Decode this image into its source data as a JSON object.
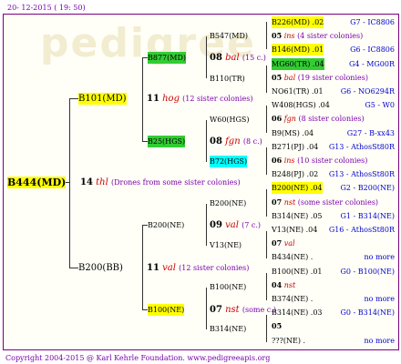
{
  "header_date": "20- 12-2015 ( 19: 50)",
  "footer": "Copyright 2004-2015 @ Karl Kehrle Foundation.   www.pedigreeapis.org",
  "watermark": "pedigree",
  "root": {
    "id": "B444(MD)"
  },
  "gen1": [
    {
      "id": "B101(MD)",
      "year": "11",
      "name": "hog",
      "note": "(12 sister colonies)"
    },
    {
      "id": "B200(BB)",
      "year": "11",
      "name": "val",
      "note": "(12 sister colonies)"
    }
  ],
  "root_mid": {
    "year": "14",
    "name": "thl",
    "note": "(Drones from some sister colonies)"
  },
  "gen2": [
    {
      "id": "B877(MD)",
      "year": "08",
      "name": "bal",
      "note": "(15 c.)"
    },
    {
      "id": "B25(HGS)",
      "year": "08",
      "name": "fgn",
      "note": "(8 c.)"
    },
    {
      "id": "B200(NE)",
      "year": "09",
      "name": "val",
      "note": "(7 c.)"
    },
    {
      "id": "B100(NE)",
      "year": "07",
      "name": "nst",
      "note": "(some c.)"
    }
  ],
  "gen3": [
    {
      "id": "B547(MD)"
    },
    {
      "id": "B110(TR)"
    },
    {
      "id": "W60(HGS)"
    },
    {
      "id": "B72(HGS)"
    },
    {
      "id": "B200(NE)"
    },
    {
      "id": "V13(NE)"
    },
    {
      "id": "B100(NE)"
    },
    {
      "id": "B314(NE)"
    }
  ],
  "gen4": [
    {
      "queen": "B226(MD) .02",
      "right": "G7 - IC8806"
    },
    {
      "year": "05",
      "name": "ins",
      "note": "(4 sister colonies)"
    },
    {
      "queen": "B146(MD) .01",
      "right": "G6 - IC8806"
    },
    {
      "queen": "MG60(TR) .04",
      "right": "G4 - MG00R"
    },
    {
      "year": "05",
      "name": "bal",
      "note": "(19 sister colonies)"
    },
    {
      "queen": "NO61(TR) .01",
      "right": "G6 - NO6294R"
    },
    {
      "queen": "W408(HGS) .04",
      "right": "G5 - W0"
    },
    {
      "year": "06",
      "name": "fgn",
      "note": "(8 sister colonies)"
    },
    {
      "queen": "B9(MS) .04",
      "right": "G27 - B-xx43"
    },
    {
      "queen": "B271(PJ) .04",
      "right": "G13 - AthosSt80R"
    },
    {
      "year": "06",
      "name": "ins",
      "note": "(10 sister colonies)"
    },
    {
      "queen": "B248(PJ) .02",
      "right": "G13 - AthosSt80R"
    },
    {
      "queen": "B200(NE) .04",
      "right": "G2 - B200(NE)"
    },
    {
      "year": "07",
      "name": "nst",
      "note": "(some sister colonies)"
    },
    {
      "queen": "B314(NE) .05",
      "right": "G1 - B314(NE)"
    },
    {
      "queen": "V13(NE) .04",
      "right": "G16 - AthosSt80R"
    },
    {
      "year": "07",
      "name": "val",
      "note": ""
    },
    {
      "queen": "B434(NE) .",
      "right": "no more"
    },
    {
      "queen": "B100(NE) .01",
      "right": "G0 - B100(NE)"
    },
    {
      "year": "04",
      "name": "nst",
      "note": ""
    },
    {
      "queen": "B374(NE) .",
      "right": "no more"
    },
    {
      "queen": "B314(NE) .03",
      "right": "G0 - B314(NE)"
    },
    {
      "year": "05",
      "name": "",
      "note": ""
    },
    {
      "queen": "???(NE) .",
      "right": "no more"
    }
  ]
}
